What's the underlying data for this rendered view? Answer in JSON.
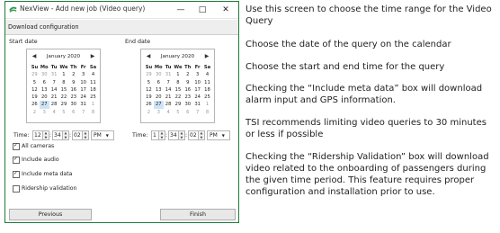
{
  "window": {
    "title": "NexView - Add new job (Video query)",
    "controls": {
      "minimize": "—",
      "maximize": "□",
      "close": "✕"
    },
    "tab": "Download configuration"
  },
  "start": {
    "label": "Start date",
    "calendar": {
      "month_label": "January 2020",
      "weekdays": [
        "Su",
        "Mo",
        "Tu",
        "We",
        "Th",
        "Fr",
        "Sa"
      ],
      "weeks": [
        [
          "29",
          "30",
          "31",
          "1",
          "2",
          "3",
          "4"
        ],
        [
          "5",
          "6",
          "7",
          "8",
          "9",
          "10",
          "11"
        ],
        [
          "12",
          "13",
          "14",
          "15",
          "16",
          "17",
          "18"
        ],
        [
          "19",
          "20",
          "21",
          "22",
          "23",
          "24",
          "25"
        ],
        [
          "26",
          "27",
          "28",
          "29",
          "30",
          "31",
          "1"
        ],
        [
          "2",
          "3",
          "4",
          "5",
          "6",
          "7",
          "8"
        ]
      ],
      "selected": "27"
    },
    "time": {
      "label": "Time:",
      "hour": "12",
      "minute": "34",
      "second": "02",
      "ampm": "PM"
    }
  },
  "end": {
    "label": "End date",
    "calendar": {
      "month_label": "January 2020",
      "weekdays": [
        "Su",
        "Mo",
        "Tu",
        "We",
        "Th",
        "Fr",
        "Sa"
      ],
      "weeks": [
        [
          "29",
          "30",
          "31",
          "1",
          "2",
          "3",
          "4"
        ],
        [
          "5",
          "6",
          "7",
          "8",
          "9",
          "10",
          "11"
        ],
        [
          "12",
          "13",
          "14",
          "15",
          "16",
          "17",
          "18"
        ],
        [
          "19",
          "20",
          "21",
          "22",
          "23",
          "24",
          "25"
        ],
        [
          "26",
          "27",
          "28",
          "29",
          "30",
          "31",
          "1"
        ],
        [
          "2",
          "3",
          "4",
          "5",
          "6",
          "7",
          "8"
        ]
      ],
      "selected": "27"
    },
    "time": {
      "label": "Time:",
      "hour": "1",
      "minute": "34",
      "second": "02",
      "ampm": "PM"
    }
  },
  "options": [
    {
      "label": "All cameras",
      "checked": true
    },
    {
      "label": "Include audio",
      "checked": true
    },
    {
      "label": "Include meta data",
      "checked": true
    },
    {
      "label": "Ridership validation",
      "checked": false
    }
  ],
  "buttons": {
    "previous": "Previous",
    "finish": "Finish"
  },
  "notes": [
    "Use this screen to choose the time range for the Video Query",
    "Choose the date of the query on the calendar",
    "Choose the start and end time for the query",
    "Checking the “Include meta data” box will download alarm input and GPS information.",
    "TSI recommends limiting video queries to 30 minutes or less if possible",
    "Checking the “Ridership Validation” box will download video related to the onboarding of passengers during the given time period. This feature requires proper configuration and installation prior to use."
  ],
  "icons": {
    "app": "nexview-app-icon",
    "prev_month": "chevron-left-icon",
    "next_month": "chevron-right-icon"
  },
  "colors": {
    "window_border": "#1e7a3a",
    "selected_day": "#cde4f7"
  }
}
